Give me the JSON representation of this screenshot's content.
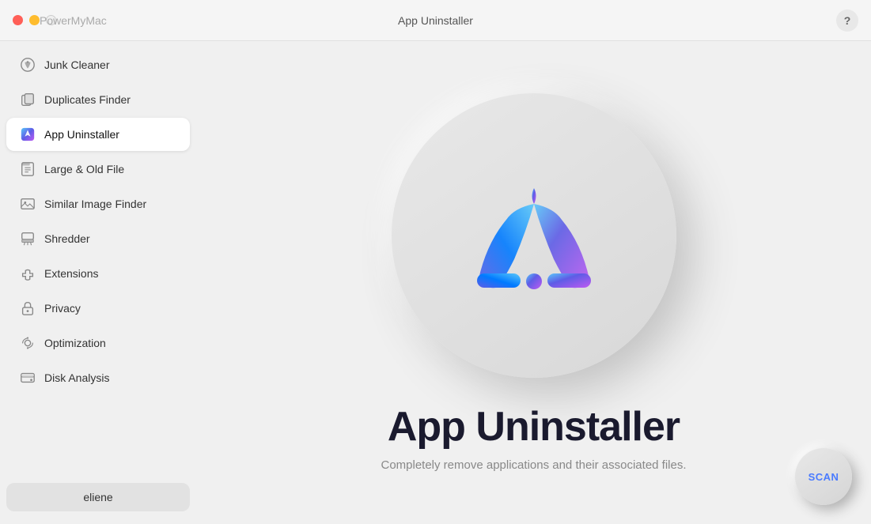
{
  "titleBar": {
    "appName": "PowerMyMac",
    "centerTitle": "App Uninstaller",
    "helpLabel": "?"
  },
  "sidebar": {
    "items": [
      {
        "id": "junk-cleaner",
        "label": "Junk Cleaner",
        "icon": "junk-icon",
        "active": false
      },
      {
        "id": "duplicates-finder",
        "label": "Duplicates Finder",
        "icon": "duplicates-icon",
        "active": false
      },
      {
        "id": "app-uninstaller",
        "label": "App Uninstaller",
        "icon": "app-uninstaller-icon",
        "active": true
      },
      {
        "id": "large-old-file",
        "label": "Large & Old File",
        "icon": "large-file-icon",
        "active": false
      },
      {
        "id": "similar-image-finder",
        "label": "Similar Image Finder",
        "icon": "image-icon",
        "active": false
      },
      {
        "id": "shredder",
        "label": "Shredder",
        "icon": "shredder-icon",
        "active": false
      },
      {
        "id": "extensions",
        "label": "Extensions",
        "icon": "extensions-icon",
        "active": false
      },
      {
        "id": "privacy",
        "label": "Privacy",
        "icon": "privacy-icon",
        "active": false
      },
      {
        "id": "optimization",
        "label": "Optimization",
        "icon": "optimization-icon",
        "active": false
      },
      {
        "id": "disk-analysis",
        "label": "Disk Analysis",
        "icon": "disk-icon",
        "active": false
      }
    ],
    "user": {
      "label": "eliene"
    }
  },
  "content": {
    "title": "App Uninstaller",
    "subtitle": "Completely remove applications and their associated files.",
    "scanButton": "SCAN"
  }
}
